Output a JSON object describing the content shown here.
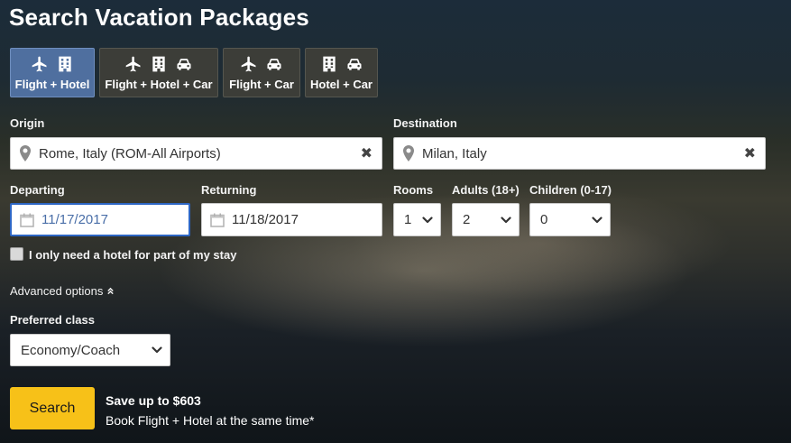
{
  "header": {
    "title": "Search Vacation Packages"
  },
  "tabs": [
    {
      "label": "Flight + Hotel",
      "icons": [
        "plane-icon",
        "hotel-icon"
      ],
      "active": true
    },
    {
      "label": "Flight + Hotel + Car",
      "icons": [
        "plane-icon",
        "hotel-icon",
        "car-icon"
      ],
      "active": false
    },
    {
      "label": "Flight + Car",
      "icons": [
        "plane-icon",
        "car-icon"
      ],
      "active": false
    },
    {
      "label": "Hotel + Car",
      "icons": [
        "hotel-icon",
        "car-icon"
      ],
      "active": false
    }
  ],
  "origin": {
    "label": "Origin",
    "value": "Rome, Italy (ROM-All Airports)"
  },
  "destination": {
    "label": "Destination",
    "value": "Milan, Italy"
  },
  "departing": {
    "label": "Departing",
    "value": "11/17/2017"
  },
  "returning": {
    "label": "Returning",
    "value": "11/18/2017"
  },
  "rooms": {
    "label": "Rooms",
    "value": "1"
  },
  "adults": {
    "label": "Adults (18+)",
    "value": "2"
  },
  "children": {
    "label": "Children (0-17)",
    "value": "0"
  },
  "partial_stay": {
    "label": "I only need a hotel for part of my stay",
    "checked": false
  },
  "advanced": {
    "label": "Advanced options",
    "expanded": true
  },
  "preferred_class": {
    "label": "Preferred class",
    "value": "Economy/Coach"
  },
  "search": {
    "button_label": "Search",
    "promo_title": "Save up to $603",
    "promo_text": "Book Flight + Hotel at the same time*"
  },
  "colors": {
    "accent_active_tab": "#4f6f9f",
    "search_button": "#f7c118",
    "focus_border": "#2d66c4"
  }
}
